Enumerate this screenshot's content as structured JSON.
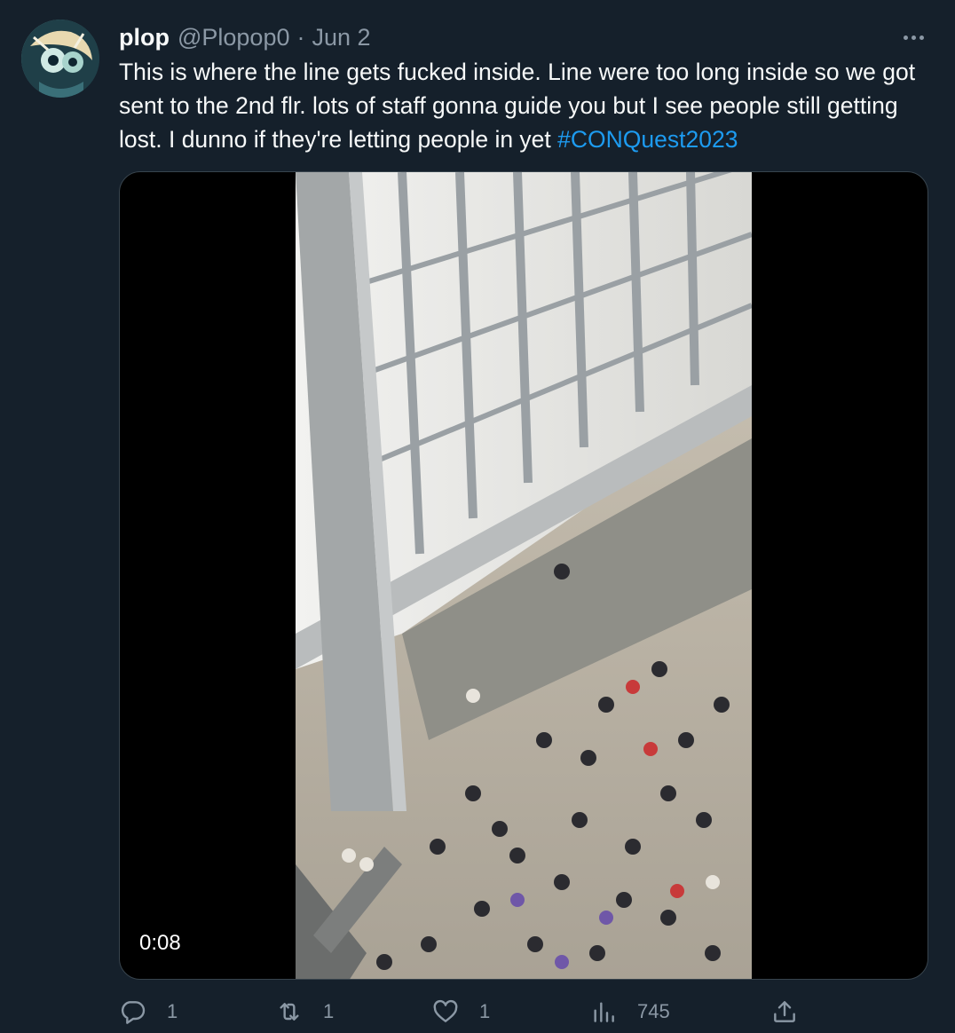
{
  "tweet": {
    "name": "plop",
    "handle": "@Plopop0",
    "separator": "·",
    "date": "Jun 2",
    "text_plain": "This is where the line gets fucked inside. Line were too long inside so we got sent to the 2nd flr. lots of staff gonna guide you but I see people still getting lost. I dunno if they're letting people in yet ",
    "hashtag": "#CONQuest2023",
    "media": {
      "type": "video",
      "duration": "0:08"
    },
    "actions": {
      "replies": "1",
      "retweets": "1",
      "likes": "1",
      "views": "745"
    }
  },
  "icons": {
    "more": "more-horizontal-icon",
    "reply": "reply-icon",
    "retweet": "retweet-icon",
    "like": "heart-icon",
    "views": "views-chart-icon",
    "share": "share-icon"
  },
  "colors": {
    "background": "#15202b",
    "text": "#f7f9f9",
    "secondary": "#8b98a5",
    "link": "#1d9bf0",
    "border": "#38444d"
  }
}
